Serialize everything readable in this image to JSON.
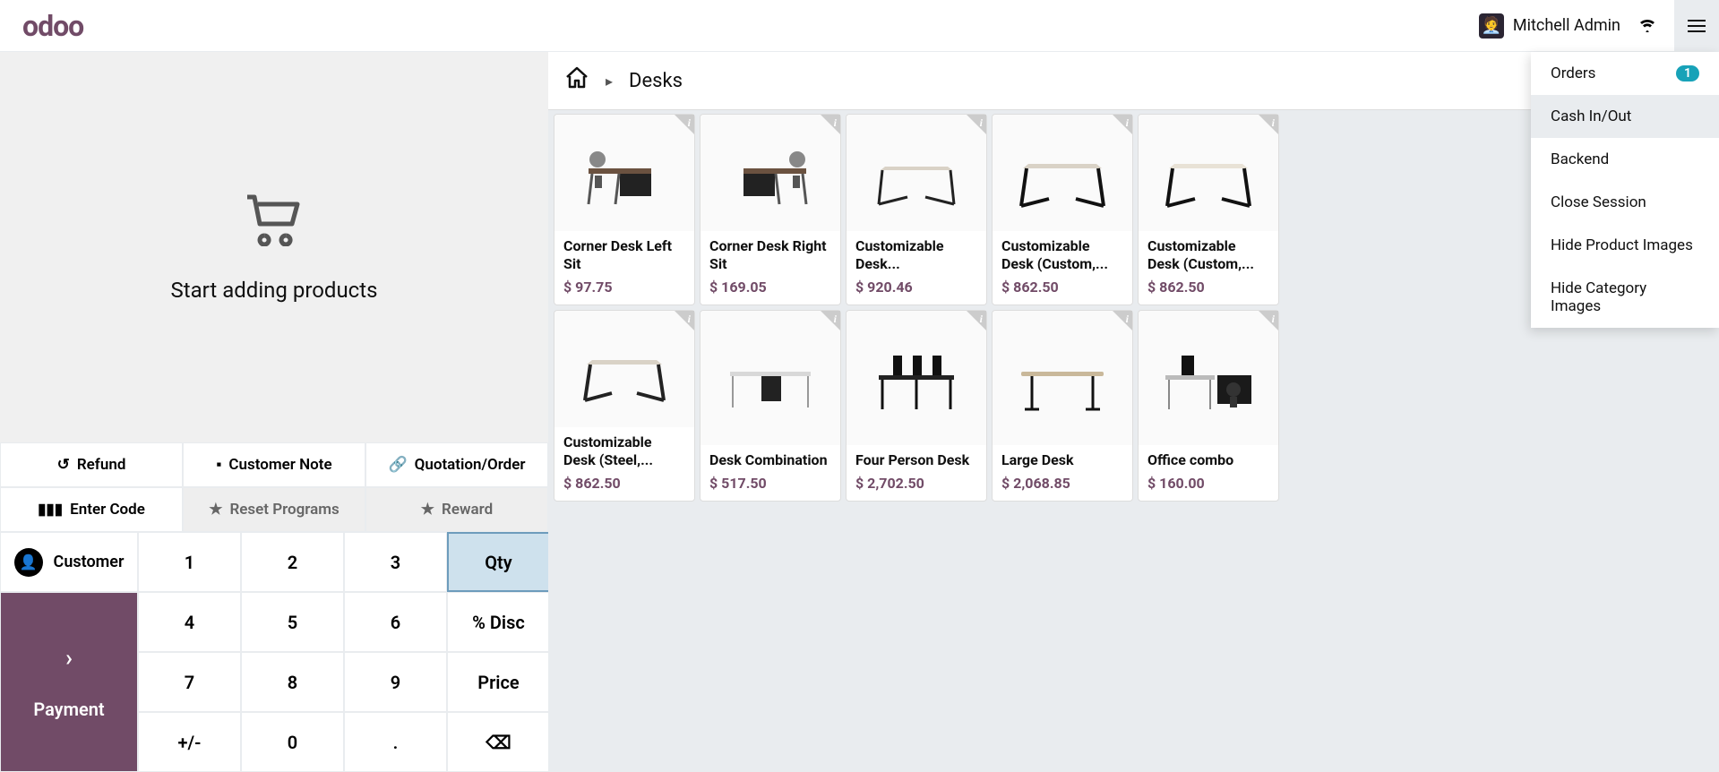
{
  "header": {
    "logo": "odoo",
    "user_name": "Mitchell Admin"
  },
  "cart": {
    "empty_text": "Start adding products"
  },
  "actions": {
    "refund": "Refund",
    "customer_note": "Customer Note",
    "quotation": "Quotation/Order",
    "enter_code": "Enter Code",
    "reset_programs": "Reset Programs",
    "reward": "Reward"
  },
  "controls": {
    "customer": "Customer",
    "payment": "Payment",
    "qty": "Qty",
    "disc": "% Disc",
    "price": "Price",
    "plusminus": "+/-",
    "dot": "."
  },
  "breadcrumb": {
    "category": "Desks"
  },
  "products": [
    {
      "name": "Corner Desk Left Sit",
      "price": "$ 97.75"
    },
    {
      "name": "Corner Desk Right Sit",
      "price": "$ 169.05"
    },
    {
      "name": "Customizable Desk...",
      "price": "$ 920.46"
    },
    {
      "name": "Customizable Desk (Custom,...",
      "price": "$ 862.50"
    },
    {
      "name": "Customizable Desk (Custom,...",
      "price": "$ 862.50"
    },
    {
      "name": "Customizable Desk (Steel,...",
      "price": "$ 862.50"
    },
    {
      "name": "Desk Combination",
      "price": "$ 517.50"
    },
    {
      "name": "Four Person Desk",
      "price": "$ 2,702.50"
    },
    {
      "name": "Large Desk",
      "price": "$ 2,068.85"
    },
    {
      "name": "Office combo",
      "price": "$ 160.00"
    }
  ],
  "menu": {
    "orders": "Orders",
    "orders_count": "1",
    "cash": "Cash In/Out",
    "backend": "Backend",
    "close": "Close Session",
    "hide_product": "Hide Product Images",
    "hide_category": "Hide Category Images"
  }
}
